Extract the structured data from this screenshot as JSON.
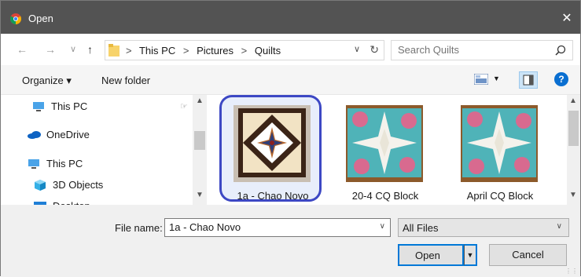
{
  "window": {
    "title": "Open",
    "close_glyph": "✕"
  },
  "nav": {
    "back": "←",
    "forward": "→",
    "recent": "∨",
    "up": "↑"
  },
  "address": {
    "crumbs": [
      "This PC",
      "Pictures",
      "Quilts"
    ],
    "separator": ">",
    "dropdown": "∨",
    "refresh": "↻"
  },
  "search": {
    "placeholder": "Search Quilts"
  },
  "toolbar": {
    "organize": "Organize ▾",
    "new_folder": "New folder",
    "view_dropdown": "▼",
    "help": "?"
  },
  "navpane": {
    "items": [
      {
        "label": "This PC",
        "icon": "computer-icon"
      },
      {
        "label": "OneDrive",
        "icon": "cloud-icon"
      },
      {
        "label": "This PC",
        "icon": "computer-icon"
      },
      {
        "label": "3D Objects",
        "icon": "cube-icon"
      },
      {
        "label": "Desktop",
        "icon": "desktop-icon"
      }
    ],
    "pin_glyph": "📌"
  },
  "files": [
    {
      "name": "1a - Chao Novo",
      "selected": true
    },
    {
      "name": "20-4 CQ Block",
      "selected": false
    },
    {
      "name": "April CQ Block",
      "selected": false
    }
  ],
  "bottom": {
    "file_name_label": "File name:",
    "file_name_value": "1a - Chao Novo",
    "filter_value": "All Files",
    "open_label": "Open",
    "cancel_label": "Cancel",
    "dropdown_glyph": "∨",
    "split_glyph": "▼"
  },
  "colors": {
    "titlebar": "#535353",
    "selection_outline": "#3d48c4",
    "accent": "#0078d7"
  }
}
